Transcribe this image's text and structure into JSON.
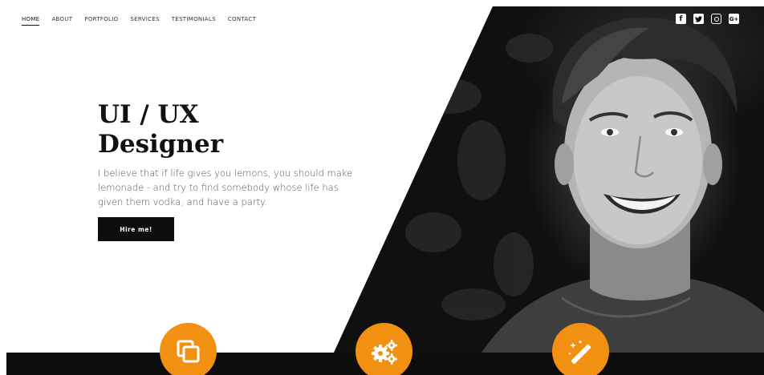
{
  "nav": {
    "items": [
      {
        "label": "HOME",
        "active": true
      },
      {
        "label": "ABOUT",
        "active": false
      },
      {
        "label": "PORTFOLIO",
        "active": false
      },
      {
        "label": "SERVICES",
        "active": false
      },
      {
        "label": "TESTIMONIALS",
        "active": false
      },
      {
        "label": "CONTACT",
        "active": false
      }
    ]
  },
  "social": {
    "facebook": "f",
    "twitter": "twitter-icon",
    "instagram": "instagram-icon",
    "googleplus": "G+"
  },
  "hero": {
    "title_line1": "UI / UX",
    "title_line2": "Designer",
    "description": "I believe that if life gives you lemons, you should make lemonade - and try to find somebody whose life has given them vodka, and have a party.",
    "button_label": "Hire me!"
  },
  "features": [
    {
      "icon": "copy-icon"
    },
    {
      "icon": "gears-icon"
    },
    {
      "icon": "magic-wand-icon"
    }
  ],
  "colors": {
    "accent": "#f29111",
    "dark": "#0d0d0d",
    "background": "#ffffff"
  }
}
